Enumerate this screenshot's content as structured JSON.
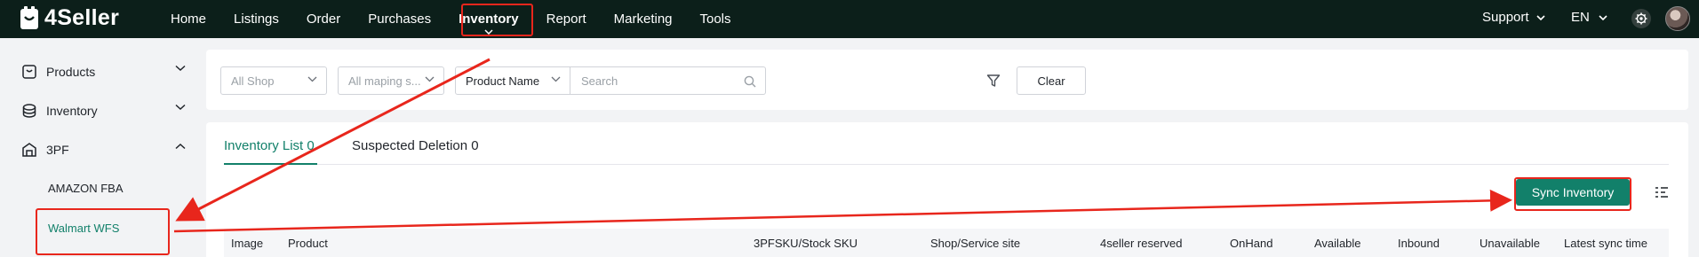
{
  "app": {
    "name": "4Seller"
  },
  "topnav": {
    "items": [
      {
        "label": "Home"
      },
      {
        "label": "Listings"
      },
      {
        "label": "Order"
      },
      {
        "label": "Purchases"
      },
      {
        "label": "Inventory"
      },
      {
        "label": "Report"
      },
      {
        "label": "Marketing"
      },
      {
        "label": "Tools"
      }
    ],
    "active": "Inventory",
    "support": "Support",
    "language": "EN"
  },
  "sidebar": {
    "groups": [
      {
        "label": "Products"
      },
      {
        "label": "Inventory"
      },
      {
        "label": "3PF"
      }
    ],
    "subitems": [
      {
        "label": "AMAZON FBA"
      },
      {
        "label": "Walmart WFS"
      }
    ]
  },
  "filters": {
    "shop": "All Shop",
    "mapping": "All maping s...",
    "field": "Product Name",
    "search_placeholder": "Search",
    "clear": "Clear"
  },
  "tabs": [
    {
      "label": "Inventory List 0"
    },
    {
      "label": "Suspected Deletion 0"
    }
  ],
  "actions": {
    "sync": "Sync Inventory"
  },
  "table": {
    "columns": [
      "Image",
      "Product",
      "3PFSKU/Stock SKU",
      "Shop/Service site",
      "4seller reserved",
      "OnHand",
      "Available",
      "Inbound",
      "Unavailable",
      "Latest sync time"
    ]
  },
  "colors": {
    "brand": "#12806a",
    "topbar": "#0c1f1a",
    "annotation": "#e8261c"
  }
}
